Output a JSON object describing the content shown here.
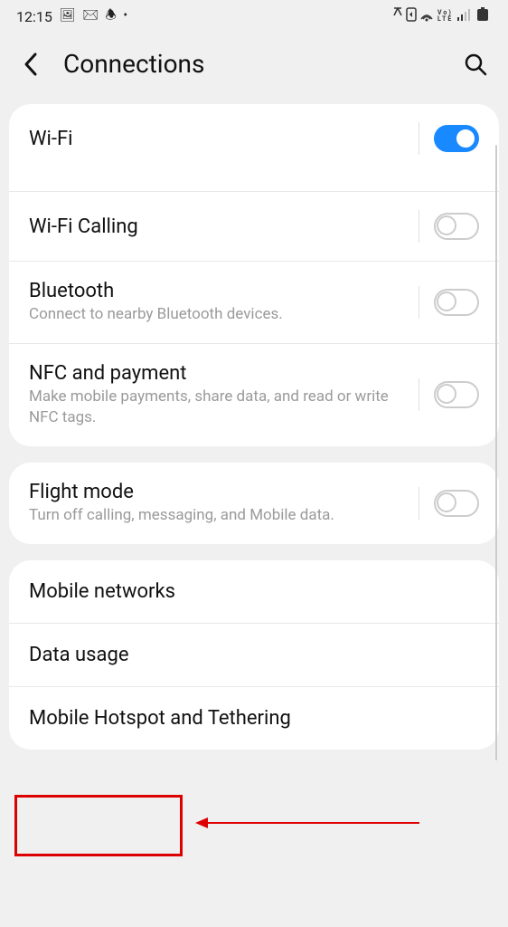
{
  "status": {
    "time": "12:15",
    "left_icons": "🖼 📧 🔔 •",
    "right_icons": "🔇 ⬇ 📶 LTE 📶 🔋"
  },
  "header": {
    "title": "Connections"
  },
  "groups": [
    {
      "items": [
        {
          "title": "Wi-Fi",
          "subtitle": "",
          "toggle": true,
          "on": true,
          "extra_pad": true
        },
        {
          "title": "Wi-Fi Calling",
          "subtitle": "",
          "toggle": true,
          "on": false
        },
        {
          "title": "Bluetooth",
          "subtitle": "Connect to nearby Bluetooth devices.",
          "toggle": true,
          "on": false
        },
        {
          "title": "NFC and payment",
          "subtitle": "Make mobile payments, share data, and read or write NFC tags.",
          "toggle": true,
          "on": false
        }
      ]
    },
    {
      "items": [
        {
          "title": "Flight mode",
          "subtitle": "Turn off calling, messaging, and Mobile data.",
          "toggle": true,
          "on": false
        }
      ]
    },
    {
      "items": [
        {
          "title": "Mobile networks",
          "subtitle": "",
          "toggle": false
        },
        {
          "title": "Data usage",
          "subtitle": "",
          "toggle": false
        },
        {
          "title": "Mobile Hotspot and Tethering",
          "subtitle": "",
          "toggle": false
        }
      ]
    }
  ]
}
